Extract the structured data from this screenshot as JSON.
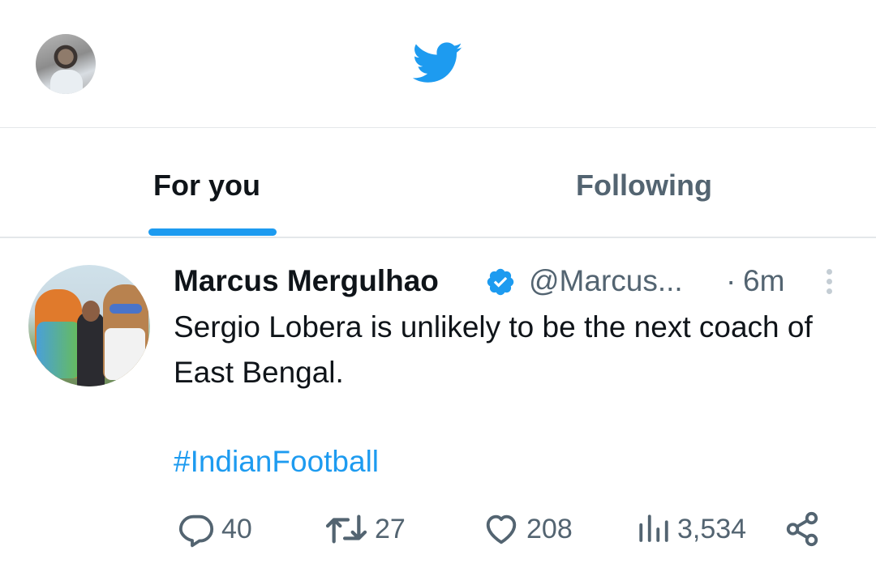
{
  "header": {
    "avatar_icon": "user-avatar",
    "logo_icon": "twitter-bird-icon",
    "logo_color": "#1d9bf0"
  },
  "tabs": [
    {
      "label": "For you",
      "active": true
    },
    {
      "label": "Following",
      "active": false
    }
  ],
  "tweet": {
    "author_name": "Marcus Mergulhao",
    "verified": true,
    "handle": "@Marcus...",
    "separator": "·",
    "time": "6m",
    "text": "Sergio Lobera is unlikely to be the next coach of East Bengal.",
    "hashtag": "#IndianFootball",
    "stats": {
      "replies": "40",
      "retweets": "27",
      "likes": "208",
      "views": "3,534"
    }
  },
  "colors": {
    "accent": "#1d9bf0",
    "text_primary": "#0f1419",
    "text_secondary": "#536471",
    "divider": "#e4e7ea"
  }
}
